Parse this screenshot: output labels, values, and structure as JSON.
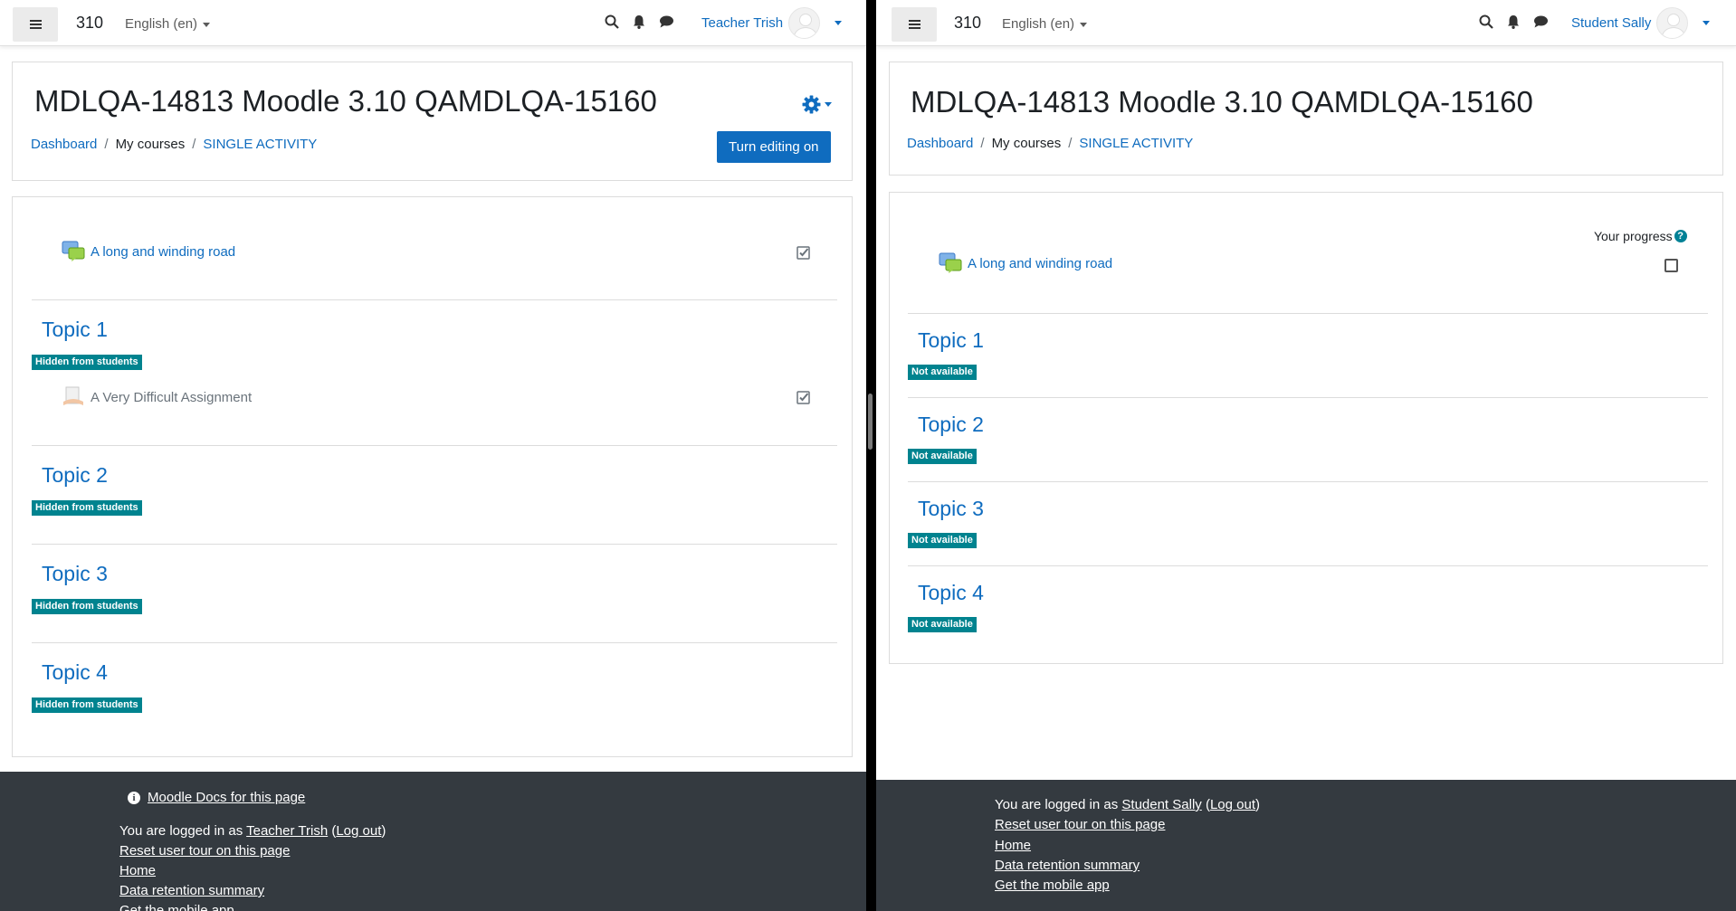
{
  "left": {
    "site_name": "310",
    "language": "English (en)",
    "user_name": "Teacher Trish",
    "course_title": "MDLQA-14813 Moodle 3.10 QAMDLQA-15160",
    "breadcrumb": [
      "Dashboard",
      "My courses",
      "SINGLE ACTIVITY"
    ],
    "edit_button": "Turn editing on",
    "activity": "A long and winding road",
    "topic1_activity": "A Very Difficult Assignment",
    "topics": [
      "Topic 1",
      "Topic 2",
      "Topic 3",
      "Topic 4"
    ],
    "topic_badge": "Hidden from students",
    "footer": {
      "docs_link": "Moodle Docs for this page",
      "logged_in_prefix": "You are logged in as ",
      "user_link": "Teacher Trish",
      "logout": "Log out",
      "links": [
        "Reset user tour on this page",
        "Home",
        "Data retention summary",
        "Get the mobile app"
      ]
    }
  },
  "right": {
    "site_name": "310",
    "language": "English (en)",
    "user_name": "Student Sally",
    "course_title": "MDLQA-14813 Moodle 3.10 QAMDLQA-15160",
    "breadcrumb": [
      "Dashboard",
      "My courses",
      "SINGLE ACTIVITY"
    ],
    "progress_label": "Your progress",
    "activity": "A long and winding road",
    "topics": [
      "Topic 1",
      "Topic 2",
      "Topic 3",
      "Topic 4"
    ],
    "topic_badge": "Not available",
    "footer": {
      "logged_in_prefix": "You are logged in as ",
      "user_link": "Student Sally",
      "logout": "Log out",
      "links": [
        "Reset user tour on this page",
        "Home",
        "Data retention summary",
        "Get the mobile app"
      ]
    }
  },
  "colors": {
    "link": "#0f6cbf",
    "badge": "#00838f",
    "footer_bg": "#343a40"
  }
}
